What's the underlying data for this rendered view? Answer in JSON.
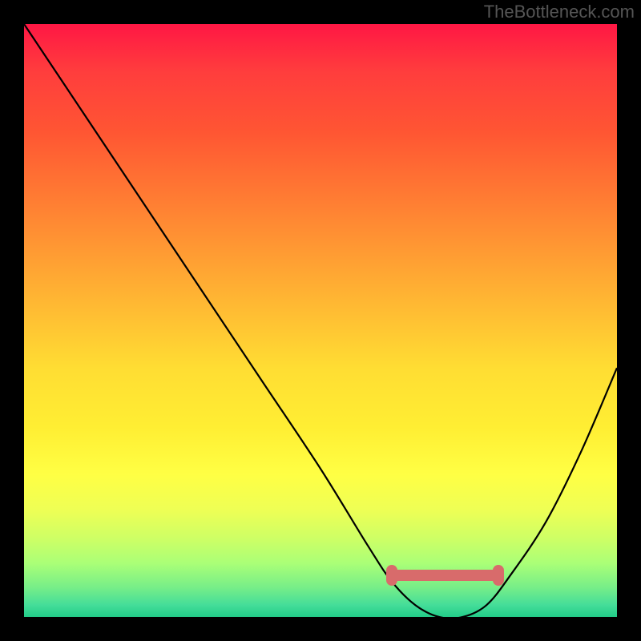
{
  "watermark": "TheBottleneck.com",
  "chart_data": {
    "type": "line",
    "title": "",
    "xlabel": "",
    "ylabel": "",
    "xlim": [
      0,
      100
    ],
    "ylim": [
      0,
      100
    ],
    "series": [
      {
        "name": "bottleneck-curve",
        "x": [
          0,
          10,
          20,
          30,
          40,
          50,
          58,
          62,
          66,
          70,
          74,
          78,
          82,
          88,
          94,
          100
        ],
        "y": [
          100,
          85,
          70,
          55,
          40,
          25,
          12,
          6,
          2,
          0,
          0,
          2,
          7,
          16,
          28,
          42
        ]
      }
    ],
    "optimal_band": {
      "x_start": 62,
      "x_end": 80,
      "y": 7
    },
    "colors": {
      "curve": "#000000",
      "band": "#d86b6b",
      "dot": "#d86b6b"
    },
    "grid": false,
    "legend": false
  }
}
